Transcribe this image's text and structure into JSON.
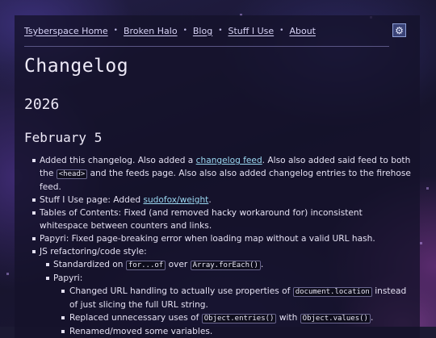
{
  "nav": {
    "items": [
      {
        "label": "Tsyberspace Home"
      },
      {
        "label": "Broken Halo"
      },
      {
        "label": "Blog"
      },
      {
        "label": "Stuff I Use"
      },
      {
        "label": "About"
      }
    ],
    "separator": "•",
    "settings_icon": "gear-icon",
    "settings_glyph": "⚙"
  },
  "page": {
    "title": "Changelog",
    "year": "2026",
    "date": "February 5"
  },
  "entries": {
    "e1": {
      "t1": "Added this changelog. Also added a ",
      "link1": "changelog feed",
      "t2": ". Also also added said feed to both the ",
      "code1": "<head>",
      "t3": " and the feeds page. Also also also added changelog entries to the firehose feed."
    },
    "e2": {
      "t1": "Stuff I Use page: Added ",
      "link1": "sudofox/weight",
      "t2": "."
    },
    "e3": {
      "t1": "Tables of Contents: Fixed (and removed hacky workaround for) inconsistent whitespace between counters and links."
    },
    "e4": {
      "t1": "Papyri: Fixed page-breaking error when loading map without a valid URL hash."
    },
    "e5": {
      "t1": "JS refactoring/code style:",
      "sub1": {
        "t1": "Standardized on ",
        "code1": "for...of",
        "t2": " over ",
        "code2": "Array.forEach()",
        "t3": "."
      },
      "sub2": {
        "t1": "Papyri:",
        "s1": {
          "t1": "Changed URL handling to actually use properties of ",
          "code1": "document.location",
          "t2": " instead of just slicing the full URL string."
        },
        "s2": {
          "t1": "Replaced unnecessary uses of ",
          "code1": "Object.entries()",
          "t2": " with ",
          "code2": "Object.values()",
          "t3": "."
        },
        "s3": {
          "t1": "Renamed/moved some variables."
        }
      }
    }
  }
}
